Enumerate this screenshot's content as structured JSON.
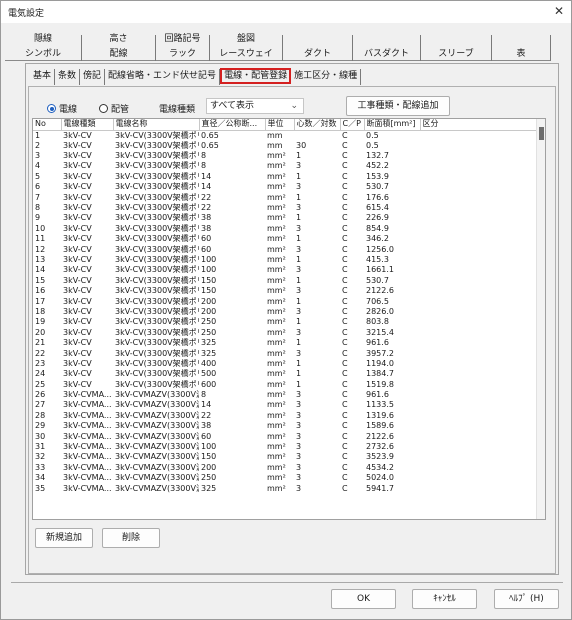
{
  "window": {
    "title": "電気設定"
  },
  "tabs": {
    "top_row": [
      {
        "label": "隠線"
      },
      {
        "label": "高さ"
      },
      {
        "label": "回路記号"
      },
      {
        "label": "盤図"
      }
    ],
    "bottom_row": [
      {
        "label": "シンボル"
      },
      {
        "label": "配線"
      },
      {
        "label": "ラック"
      },
      {
        "label": "レースウェイ"
      },
      {
        "label": "ダクト"
      },
      {
        "label": "バスダクト"
      },
      {
        "label": "スリーブ"
      },
      {
        "label": "表"
      }
    ]
  },
  "subtabs": [
    {
      "label": "基本"
    },
    {
      "label": "条数"
    },
    {
      "label": "傍記"
    },
    {
      "label": "配線省略・エンド伏せ記号"
    },
    {
      "label": "電線・配管登録",
      "active": true
    },
    {
      "label": "施工区分・線種"
    }
  ],
  "options": {
    "radio_wire": "電線",
    "radio_pipe": "配管",
    "wire_type_label": "電線種類",
    "wire_type_value": "すべて表示",
    "add_button": "工事種類・配線追加"
  },
  "grid": {
    "columns": [
      "No",
      "電線種類",
      "電線名称",
      "直径／公称断...",
      "単位",
      "心数／対数",
      "C／P",
      "断面積[mm²]",
      "区分"
    ],
    "rows": [
      [
        "1",
        "3kV-CV",
        "3kV-CV(3300V架橋ポリ...",
        "0.65",
        "mm",
        "",
        "C",
        "0.5",
        ""
      ],
      [
        "2",
        "3kV-CV",
        "3kV-CV(3300V架橋ポリ...",
        "0.65",
        "mm",
        "30",
        "C",
        "0.5",
        ""
      ],
      [
        "3",
        "3kV-CV",
        "3kV-CV(3300V架橋ポリ...",
        "8",
        "mm²",
        "1",
        "C",
        "132.7",
        ""
      ],
      [
        "4",
        "3kV-CV",
        "3kV-CV(3300V架橋ポリ...",
        "8",
        "mm²",
        "3",
        "C",
        "452.2",
        ""
      ],
      [
        "5",
        "3kV-CV",
        "3kV-CV(3300V架橋ポリ...",
        "14",
        "mm²",
        "1",
        "C",
        "153.9",
        ""
      ],
      [
        "6",
        "3kV-CV",
        "3kV-CV(3300V架橋ポリ...",
        "14",
        "mm²",
        "3",
        "C",
        "530.7",
        ""
      ],
      [
        "7",
        "3kV-CV",
        "3kV-CV(3300V架橋ポリ...",
        "22",
        "mm²",
        "1",
        "C",
        "176.6",
        ""
      ],
      [
        "8",
        "3kV-CV",
        "3kV-CV(3300V架橋ポリ...",
        "22",
        "mm²",
        "3",
        "C",
        "615.4",
        ""
      ],
      [
        "9",
        "3kV-CV",
        "3kV-CV(3300V架橋ポリ...",
        "38",
        "mm²",
        "1",
        "C",
        "226.9",
        ""
      ],
      [
        "10",
        "3kV-CV",
        "3kV-CV(3300V架橋ポリ...",
        "38",
        "mm²",
        "3",
        "C",
        "854.9",
        ""
      ],
      [
        "11",
        "3kV-CV",
        "3kV-CV(3300V架橋ポリ...",
        "60",
        "mm²",
        "1",
        "C",
        "346.2",
        ""
      ],
      [
        "12",
        "3kV-CV",
        "3kV-CV(3300V架橋ポリ...",
        "60",
        "mm²",
        "3",
        "C",
        "1256.0",
        ""
      ],
      [
        "13",
        "3kV-CV",
        "3kV-CV(3300V架橋ポリ...",
        "100",
        "mm²",
        "1",
        "C",
        "415.3",
        ""
      ],
      [
        "14",
        "3kV-CV",
        "3kV-CV(3300V架橋ポリ...",
        "100",
        "mm²",
        "3",
        "C",
        "1661.1",
        ""
      ],
      [
        "15",
        "3kV-CV",
        "3kV-CV(3300V架橋ポリ...",
        "150",
        "mm²",
        "1",
        "C",
        "530.7",
        ""
      ],
      [
        "16",
        "3kV-CV",
        "3kV-CV(3300V架橋ポリ...",
        "150",
        "mm²",
        "3",
        "C",
        "2122.6",
        ""
      ],
      [
        "17",
        "3kV-CV",
        "3kV-CV(3300V架橋ポリ...",
        "200",
        "mm²",
        "1",
        "C",
        "706.5",
        ""
      ],
      [
        "18",
        "3kV-CV",
        "3kV-CV(3300V架橋ポリ...",
        "200",
        "mm²",
        "3",
        "C",
        "2826.0",
        ""
      ],
      [
        "19",
        "3kV-CV",
        "3kV-CV(3300V架橋ポリ...",
        "250",
        "mm²",
        "1",
        "C",
        "803.8",
        ""
      ],
      [
        "20",
        "3kV-CV",
        "3kV-CV(3300V架橋ポリ...",
        "250",
        "mm²",
        "3",
        "C",
        "3215.4",
        ""
      ],
      [
        "21",
        "3kV-CV",
        "3kV-CV(3300V架橋ポリ...",
        "325",
        "mm²",
        "1",
        "C",
        "961.6",
        ""
      ],
      [
        "22",
        "3kV-CV",
        "3kV-CV(3300V架橋ポリ...",
        "325",
        "mm²",
        "3",
        "C",
        "3957.2",
        ""
      ],
      [
        "23",
        "3kV-CV",
        "3kV-CV(3300V架橋ポリ...",
        "400",
        "mm²",
        "1",
        "C",
        "1194.0",
        ""
      ],
      [
        "24",
        "3kV-CV",
        "3kV-CV(3300V架橋ポリ...",
        "500",
        "mm²",
        "1",
        "C",
        "1384.7",
        ""
      ],
      [
        "25",
        "3kV-CV",
        "3kV-CV(3300V架橋ポリ...",
        "600",
        "mm²",
        "1",
        "C",
        "1519.8",
        ""
      ],
      [
        "26",
        "3kV-CVMA...",
        "3kV-CVMAZV(3300V波...",
        "8",
        "mm²",
        "3",
        "C",
        "961.6",
        ""
      ],
      [
        "27",
        "3kV-CVMA...",
        "3kV-CVMAZV(3300V波...",
        "14",
        "mm²",
        "3",
        "C",
        "1133.5",
        ""
      ],
      [
        "28",
        "3kV-CVMA...",
        "3kV-CVMAZV(3300V波...",
        "22",
        "mm²",
        "3",
        "C",
        "1319.6",
        ""
      ],
      [
        "29",
        "3kV-CVMA...",
        "3kV-CVMAZV(3300V波...",
        "38",
        "mm²",
        "3",
        "C",
        "1589.6",
        ""
      ],
      [
        "30",
        "3kV-CVMA...",
        "3kV-CVMAZV(3300V波...",
        "60",
        "mm²",
        "3",
        "C",
        "2122.6",
        ""
      ],
      [
        "31",
        "3kV-CVMA...",
        "3kV-CVMAZV(3300V波...",
        "100",
        "mm²",
        "3",
        "C",
        "2732.6",
        ""
      ],
      [
        "32",
        "3kV-CVMA...",
        "3kV-CVMAZV(3300V波...",
        "150",
        "mm²",
        "3",
        "C",
        "3523.9",
        ""
      ],
      [
        "33",
        "3kV-CVMA...",
        "3kV-CVMAZV(3300V波...",
        "200",
        "mm²",
        "3",
        "C",
        "4534.2",
        ""
      ],
      [
        "34",
        "3kV-CVMA...",
        "3kV-CVMAZV(3300V波...",
        "250",
        "mm²",
        "3",
        "C",
        "5024.0",
        ""
      ],
      [
        "35",
        "3kV-CVMA...",
        "3kV-CVMAZV(3300V波...",
        "325",
        "mm²",
        "3",
        "C",
        "5941.7",
        ""
      ]
    ]
  },
  "buttons": {
    "new_add": "新規追加",
    "delete": "削除",
    "ok": "OK",
    "cancel": "ｷｬﾝｾﾙ",
    "help": "ﾍﾙﾌﾟ (H)"
  },
  "icons": {
    "close": "close-icon",
    "chevron": "chevron-down-icon"
  },
  "colors": {
    "active_tab_border": "#d42020",
    "radio_accent": "#1f5fbf"
  }
}
